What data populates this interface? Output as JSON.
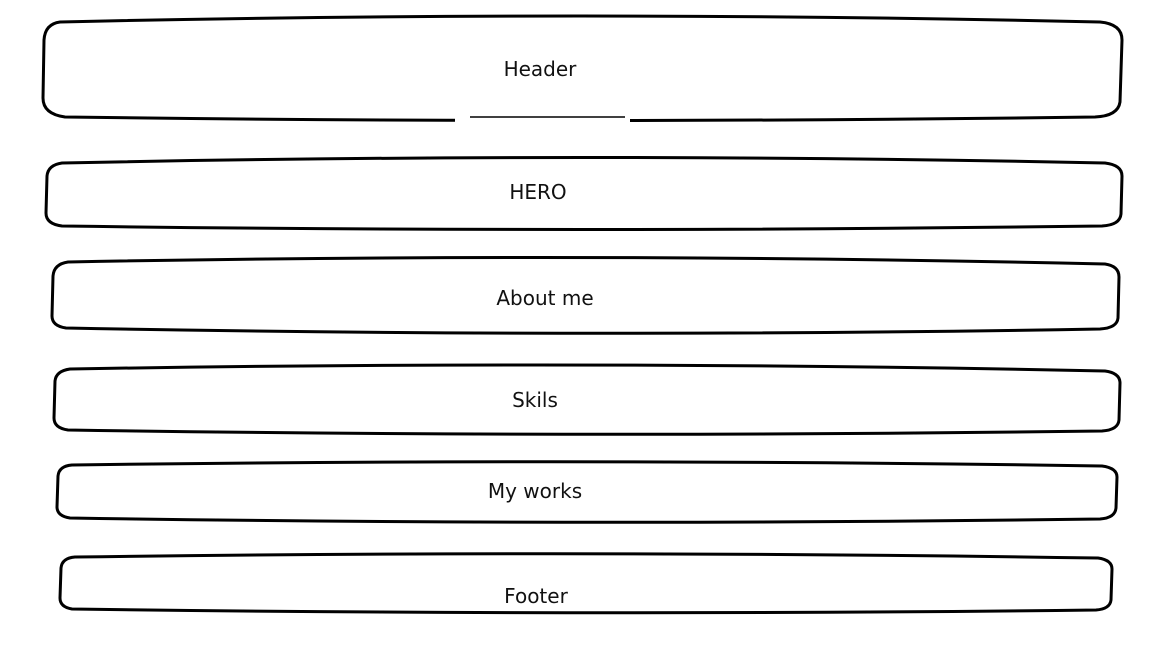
{
  "blocks": [
    {
      "label": "Header"
    },
    {
      "label": "HERO"
    },
    {
      "label": "About me"
    },
    {
      "label": "Skils"
    },
    {
      "label": "My works"
    },
    {
      "label": "Footer"
    }
  ],
  "colors": {
    "stroke": "#000000",
    "fill": "#ffffff",
    "text": "#111111"
  }
}
